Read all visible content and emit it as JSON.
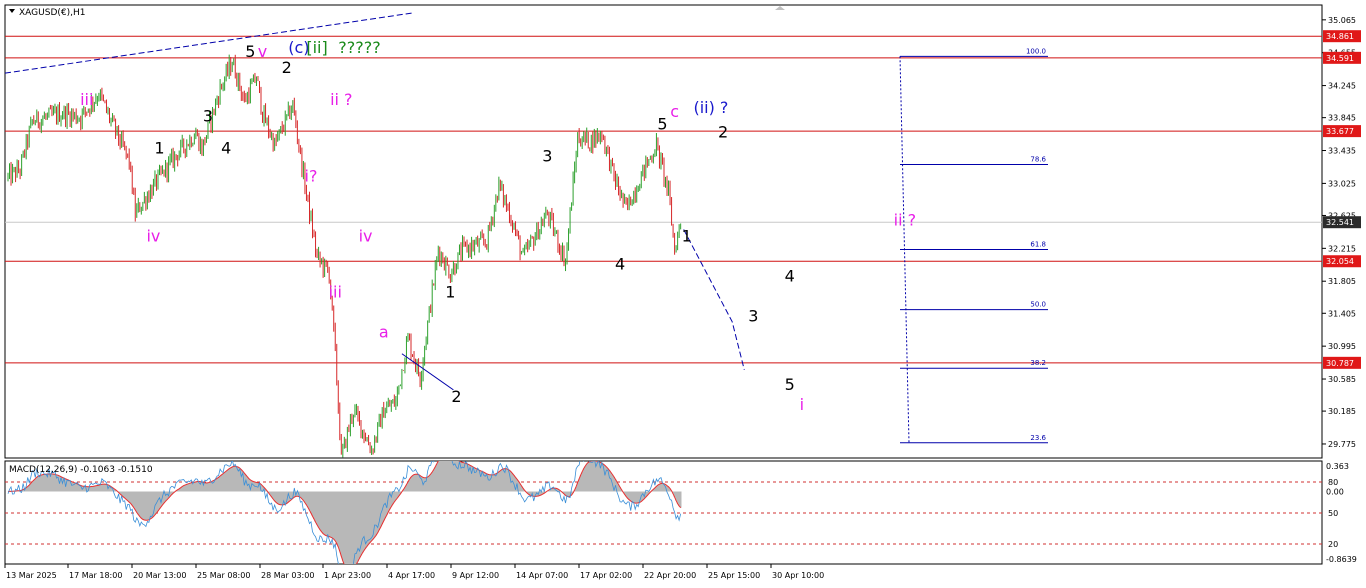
{
  "header": {
    "symbol_label": "XAGUSD(€),H1",
    "menu_icon": "triangle-down-icon"
  },
  "colors": {
    "background": "#ffffff",
    "candle_up": "#2ca02c",
    "candle_down": "#d62728",
    "hline": "#d01010",
    "fib": "#0000aa",
    "wave_black": "#000000",
    "wave_magenta": "#e81fe8",
    "wave_blue": "#1a1acc",
    "wave_green": "#1a8a1a",
    "macd_hist": "#b8b8b8",
    "macd_signal": "#e83030",
    "macd_line": "#3a8fd8",
    "price_tag_bg": "#e01818",
    "current_tag_bg": "#2b2b2b"
  },
  "chart_data": [
    {
      "type": "candlestick",
      "symbol": "XAGUSD(€)",
      "timeframe": "H1",
      "ylim": [
        29.6,
        35.25
      ],
      "y_ticks": [
        "35.065",
        "34.655",
        "34.245",
        "33.845",
        "33.435",
        "33.025",
        "32.625",
        "32.215",
        "31.805",
        "31.405",
        "30.995",
        "30.585",
        "30.185",
        "29.775"
      ],
      "x_ticks": [
        "13 Mar 2025",
        "17 Mar 18:00",
        "20 Mar 13:00",
        "25 Mar 08:00",
        "28 Mar 03:00",
        "1 Apr 23:00",
        "4 Apr 17:00",
        "9 Apr 12:00",
        "14 Apr 07:00",
        "17 Apr 02:00",
        "22 Apr 20:00",
        "25 Apr 15:00",
        "30 Apr 10:00"
      ],
      "price_path": [
        {
          "t": 0,
          "p": 33.1
        },
        {
          "t": 2,
          "p": 33.2
        },
        {
          "t": 4,
          "p": 33.8
        },
        {
          "t": 9,
          "p": 33.9
        },
        {
          "t": 12,
          "p": 33.85
        },
        {
          "t": 15,
          "p": 34.15
        },
        {
          "t": 17,
          "p": 33.8
        },
        {
          "t": 20,
          "p": 33.3
        },
        {
          "t": 21,
          "p": 32.65
        },
        {
          "t": 25,
          "p": 33.1
        },
        {
          "t": 28,
          "p": 33.4
        },
        {
          "t": 31,
          "p": 33.65
        },
        {
          "t": 32,
          "p": 33.45
        },
        {
          "t": 35,
          "p": 34.2
        },
        {
          "t": 37,
          "p": 34.55
        },
        {
          "t": 39,
          "p": 34.05
        },
        {
          "t": 41,
          "p": 34.35
        },
        {
          "t": 42,
          "p": 33.9
        },
        {
          "t": 44,
          "p": 33.5
        },
        {
          "t": 47,
          "p": 34.0
        },
        {
          "t": 49,
          "p": 33.0
        },
        {
          "t": 51,
          "p": 32.1
        },
        {
          "t": 53,
          "p": 31.9
        },
        {
          "t": 54,
          "p": 30.9
        },
        {
          "t": 55,
          "p": 29.6
        },
        {
          "t": 57,
          "p": 30.2
        },
        {
          "t": 60,
          "p": 29.7
        },
        {
          "t": 62,
          "p": 30.2
        },
        {
          "t": 64,
          "p": 30.3
        },
        {
          "t": 66,
          "p": 31.1
        },
        {
          "t": 68,
          "p": 30.6
        },
        {
          "t": 71,
          "p": 32.2
        },
        {
          "t": 73,
          "p": 31.9
        },
        {
          "t": 75,
          "p": 32.2
        },
        {
          "t": 79,
          "p": 32.3
        },
        {
          "t": 81,
          "p": 33.0
        },
        {
          "t": 83,
          "p": 32.6
        },
        {
          "t": 85,
          "p": 32.1
        },
        {
          "t": 89,
          "p": 32.65
        },
        {
          "t": 92,
          "p": 32.05
        },
        {
          "t": 94,
          "p": 33.6
        },
        {
          "t": 96,
          "p": 33.55
        },
        {
          "t": 98,
          "p": 33.65
        },
        {
          "t": 100,
          "p": 33.1
        },
        {
          "t": 102,
          "p": 32.7
        },
        {
          "t": 105,
          "p": 33.2
        },
        {
          "t": 107,
          "p": 33.5
        },
        {
          "t": 109,
          "p": 32.9
        },
        {
          "t": 110,
          "p": 32.2
        },
        {
          "t": 111,
          "p": 32.54
        }
      ],
      "series": [
        {
          "name": "MACD(12,26,9)",
          "values": [
            -0.1063
          ]
        },
        {
          "name": "Signal",
          "values": [
            -0.151
          ]
        }
      ],
      "macd_axis": [
        "0.363",
        "0.00",
        "-0.8639"
      ],
      "macd_reference_levels": [
        "80",
        "50",
        "20"
      ],
      "horizontal_lines": [
        {
          "price": 34.861,
          "label": "34.861"
        },
        {
          "price": 34.591,
          "label": "34.591"
        },
        {
          "price": 33.677,
          "label": "33.677"
        },
        {
          "price": 32.054,
          "label": "32.054"
        },
        {
          "price": 30.787,
          "label": "30.787"
        }
      ],
      "current_price": {
        "price": 32.541,
        "label": "32.541"
      },
      "fibonacci": [
        {
          "level": "100.0",
          "price": 34.61
        },
        {
          "level": "78.6",
          "price": 33.26
        },
        {
          "level": "61.8",
          "price": 32.2
        },
        {
          "level": "50.0",
          "price": 31.45
        },
        {
          "level": "38.2",
          "price": 30.72
        },
        {
          "level": "23.6",
          "price": 29.79
        }
      ],
      "wave_labels": [
        {
          "text": "iii",
          "t": 13,
          "p": 34.0,
          "color": "magenta"
        },
        {
          "text": "1",
          "t": 25,
          "p": 33.4,
          "color": "black"
        },
        {
          "text": "iv",
          "t": 24,
          "p": 32.3,
          "color": "magenta"
        },
        {
          "text": "3",
          "t": 33,
          "p": 33.8,
          "color": "black"
        },
        {
          "text": "4",
          "t": 36,
          "p": 33.4,
          "color": "black"
        },
        {
          "text": "5",
          "t": 40,
          "p": 34.6,
          "color": "black"
        },
        {
          "text": "v",
          "t": 42,
          "p": 34.6,
          "color": "magenta"
        },
        {
          "text": "2",
          "t": 46,
          "p": 34.4,
          "color": "black"
        },
        {
          "text": "(c)",
          "t": 48,
          "p": 34.65,
          "color": "blue"
        },
        {
          "text": "[ii]",
          "t": 51,
          "p": 34.65,
          "color": "green"
        },
        {
          "text": "?????",
          "t": 58,
          "p": 34.65,
          "color": "green"
        },
        {
          "text": "ii ?",
          "t": 55,
          "p": 34.0,
          "color": "magenta"
        },
        {
          "text": "i?",
          "t": 50,
          "p": 33.05,
          "color": "magenta"
        },
        {
          "text": "iv",
          "t": 59,
          "p": 32.3,
          "color": "magenta"
        },
        {
          "text": "iii",
          "t": 54,
          "p": 31.6,
          "color": "magenta"
        },
        {
          "text": "a",
          "t": 62,
          "p": 31.1,
          "color": "magenta"
        },
        {
          "text": "1",
          "t": 73,
          "p": 31.6,
          "color": "black"
        },
        {
          "text": "2",
          "t": 74,
          "p": 30.3,
          "color": "black"
        },
        {
          "text": "3",
          "t": 89,
          "p": 33.3,
          "color": "black"
        },
        {
          "text": "4",
          "t": 101,
          "p": 31.95,
          "color": "black"
        },
        {
          "text": "5",
          "t": 108,
          "p": 33.7,
          "color": "black"
        },
        {
          "text": "c",
          "t": 110,
          "p": 33.85,
          "color": "magenta"
        },
        {
          "text": "(ii) ?",
          "t": 116,
          "p": 33.9,
          "color": "blue"
        },
        {
          "text": "1",
          "t": 112,
          "p": 32.3,
          "color": "black"
        },
        {
          "text": "2",
          "t": 118,
          "p": 33.6,
          "color": "black"
        },
        {
          "text": "ii ?",
          "t": 148,
          "p": 32.5,
          "color": "magenta"
        },
        {
          "text": "4",
          "t": 129,
          "p": 31.8,
          "color": "black"
        },
        {
          "text": "3",
          "t": 123,
          "p": 31.3,
          "color": "black"
        },
        {
          "text": "5",
          "t": 129,
          "p": 30.45,
          "color": "black"
        },
        {
          "text": "i",
          "t": 131,
          "p": 30.2,
          "color": "magenta"
        }
      ]
    }
  ]
}
